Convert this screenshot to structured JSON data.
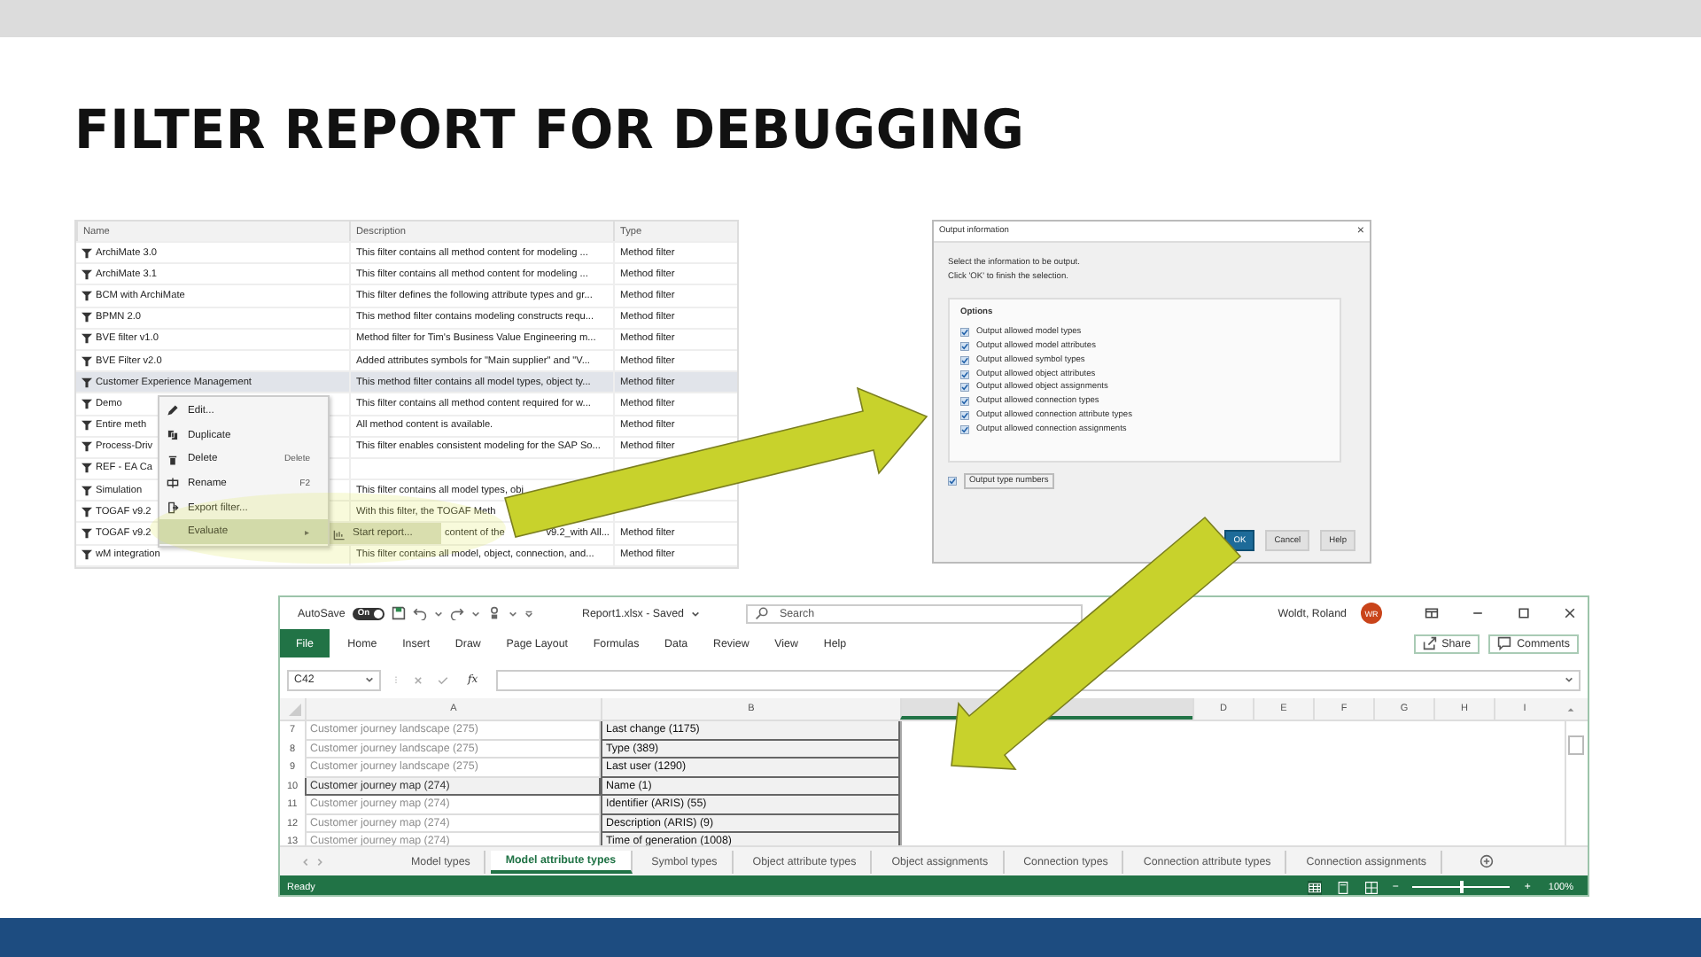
{
  "slide": {
    "title": "FILTER REPORT FOR DEBUGGING"
  },
  "filter_list": {
    "columns": [
      "Name",
      "Description",
      "Type"
    ],
    "rows": [
      {
        "name": "ArchiMate 3.0",
        "description": "This filter contains all method content for modeling ...",
        "type": "Method filter",
        "selected": false
      },
      {
        "name": "ArchiMate 3.1",
        "description": "This filter contains all method content for modeling ...",
        "type": "Method filter",
        "selected": false
      },
      {
        "name": "BCM with ArchiMate",
        "description": "This filter defines the following attribute types and gr...",
        "type": "Method filter",
        "selected": false
      },
      {
        "name": "BPMN 2.0",
        "description": "This method filter contains modeling constructs requ...",
        "type": "Method filter",
        "selected": false
      },
      {
        "name": "BVE filter v1.0",
        "description": "Method filter for Tim's Business Value Engineering m...",
        "type": "Method filter",
        "selected": false
      },
      {
        "name": "BVE Filter v2.0",
        "description": "Added attributes symbols for \"Main supplier\" and \"V...",
        "type": "Method filter",
        "selected": false
      },
      {
        "name": "Customer Experience Management",
        "description": "This method filter contains all model types, object ty...",
        "type": "Method filter",
        "selected": true
      },
      {
        "name": "Demo",
        "description": "This filter contains all method content required for w...",
        "type": "Method filter",
        "selected": false
      },
      {
        "name": "Entire meth",
        "description": "All method content is available.",
        "type": "Method filter",
        "selected": false
      },
      {
        "name": "Process-Driv",
        "description": "This filter enables consistent modeling for the SAP So...",
        "type": "Method filter",
        "selected": false
      },
      {
        "name": "REF - EA Ca",
        "selected": false
      },
      {
        "name": "Simulation",
        "description": "This filter contains all model types, obj",
        "selected": false
      },
      {
        "name": "TOGAF v9.2",
        "description": "With this filter, the TOGAF Meth",
        "selected": false
      },
      {
        "name": "TOGAF v9.2",
        "submenu": {
          "label": "Start report..."
        },
        "description": "content of the",
        "description_end": "v9.2_with All...",
        "type": "Method filter",
        "selected": false
      },
      {
        "name": "wM integration",
        "description": "This filter contains all model, object, connection, and...",
        "type": "Method filter",
        "selected": false
      }
    ]
  },
  "context_menu": {
    "items": [
      {
        "label": "Edit...",
        "selected": false
      },
      {
        "label": "Duplicate",
        "selected": false
      },
      {
        "label": "Delete",
        "shortcut": "Delete",
        "selected": false
      },
      {
        "label": "Rename",
        "shortcut": "F2",
        "selected": false
      },
      {
        "label": "Export filter...",
        "selected": false
      },
      {
        "label": "Evaluate",
        "submenu_mark": "▸",
        "selected": true
      }
    ]
  },
  "dialog": {
    "title": "Output information",
    "close": "×",
    "intro": [
      "Select the information to be output.",
      "Click 'OK' to finish the selection."
    ],
    "group": "Options",
    "options": [
      {
        "label": "Output allowed model types",
        "checked": true
      },
      {
        "label": "Output allowed model attributes",
        "checked": true
      },
      {
        "label": "Output allowed symbol types",
        "checked": true
      },
      {
        "label": "Output allowed object attributes",
        "checked": true
      },
      {
        "label": "Output allowed object assignments",
        "checked": true
      },
      {
        "label": "Output allowed connection types",
        "checked": true
      },
      {
        "label": "Output allowed connection attribute types",
        "checked": true
      },
      {
        "label": "Output allowed connection assignments",
        "checked": true
      }
    ],
    "extra_option": {
      "label": "Output type numbers",
      "checked": true
    },
    "buttons": [
      {
        "label": "OK",
        "primary": true
      },
      {
        "label": "Cancel",
        "primary": false
      },
      {
        "label": "Help",
        "primary": false
      }
    ]
  },
  "excel": {
    "autosave": {
      "label": "AutoSave",
      "on": true,
      "toggle_text": "On"
    },
    "file_title": "Report1.xlsx - Saved",
    "search": {
      "placeholder": "Search"
    },
    "user": "Woldt, Roland",
    "avatar": "WR",
    "ribbon_tabs": [
      {
        "label": "File",
        "kind": "backstage"
      },
      {
        "label": "Home",
        "kind": "tab"
      },
      {
        "label": "Insert",
        "kind": "tab"
      },
      {
        "label": "Draw",
        "kind": "tab"
      },
      {
        "label": "Page Layout",
        "kind": "tab"
      },
      {
        "label": "Formulas",
        "kind": "tab"
      },
      {
        "label": "Data",
        "kind": "tab"
      },
      {
        "label": "Review",
        "kind": "tab"
      },
      {
        "label": "View",
        "kind": "tab"
      },
      {
        "label": "Help",
        "kind": "tab"
      }
    ],
    "share": "Share",
    "comments": "Comments",
    "name_box": "C42",
    "fx": "fx",
    "columns": [
      {
        "letter": "A",
        "highlighted": false
      },
      {
        "letter": "B",
        "highlighted": false
      },
      {
        "highlighted": true
      },
      {
        "letter": "D",
        "highlighted": false
      },
      {
        "letter": "E",
        "highlighted": false
      },
      {
        "letter": "F",
        "highlighted": false
      },
      {
        "letter": "G",
        "highlighted": false
      },
      {
        "letter": "H",
        "highlighted": false
      },
      {
        "letter": "I",
        "highlighted": false
      }
    ],
    "rows": [
      {
        "number": "7",
        "a": "Customer journey landscape (275)",
        "dimmed": true,
        "b": "Last change (1175)"
      },
      {
        "number": "8",
        "a": "Customer journey landscape (275)",
        "dimmed": true,
        "b": "Type (389)"
      },
      {
        "number": "9",
        "a": "Customer journey landscape (275)",
        "dimmed": true,
        "b": "Last user (1290)"
      },
      {
        "number": "10",
        "a": "Customer journey map (274)",
        "dimmed": false,
        "b": "Name (1)"
      },
      {
        "number": "11",
        "a": "Customer journey map (274)",
        "dimmed": true,
        "b": "Identifier (ARIS) (55)"
      },
      {
        "number": "12",
        "a": "Customer journey map (274)",
        "dimmed": true,
        "b": "Description (ARIS) (9)"
      },
      {
        "number": "13",
        "a": "Customer journey map (274)",
        "dimmed": true,
        "b": "Time of generation (1008)"
      }
    ],
    "sheet_tabs": [
      {
        "label": "Model types",
        "selected": false
      },
      {
        "label": "Model attribute types",
        "selected": true
      },
      {
        "label": "Symbol types",
        "selected": false
      },
      {
        "label": "Object attribute types",
        "selected": false
      },
      {
        "label": "Object assignments",
        "selected": false
      },
      {
        "label": "Connection types",
        "selected": false
      },
      {
        "label": "Connection attribute types",
        "selected": false
      },
      {
        "label": "Connection assignments",
        "selected": false
      }
    ],
    "status": "Ready",
    "zoom": {
      "minus": "−",
      "plus": "+",
      "level": 0.5,
      "reading": "100%"
    }
  }
}
